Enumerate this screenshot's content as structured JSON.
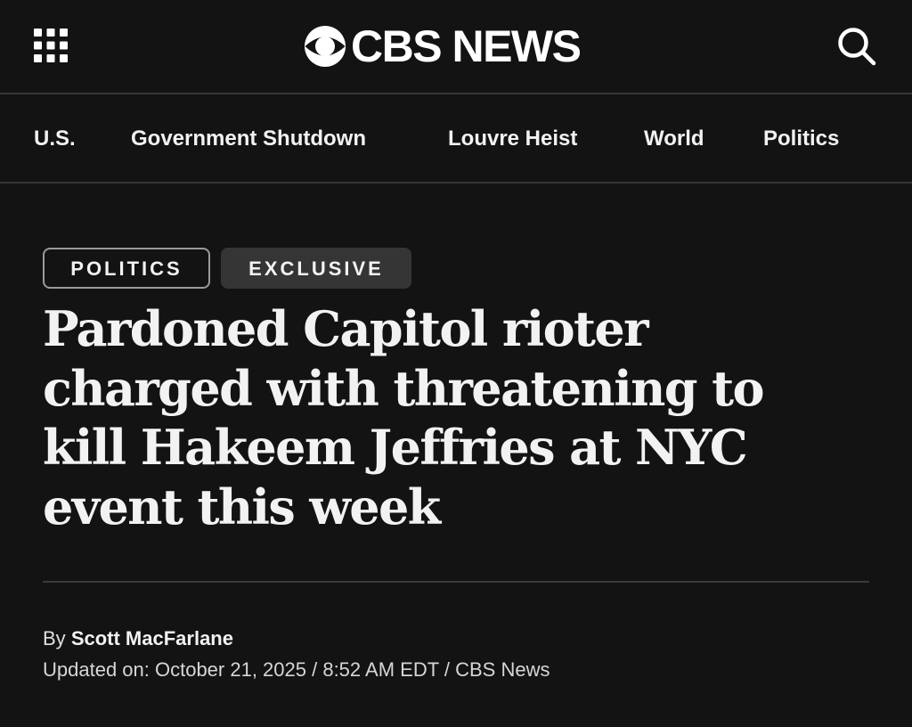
{
  "header": {
    "menu_icon": "grid-menu-icon",
    "logo_text": "CBS NEWS",
    "logo_icon": "cbs-eye-icon",
    "search_icon": "search-icon"
  },
  "nav": {
    "items": [
      {
        "label": "U.S."
      },
      {
        "label": "Government Shutdown"
      },
      {
        "label": "Louvre Heist"
      },
      {
        "label": "World"
      },
      {
        "label": "Politics"
      }
    ]
  },
  "article": {
    "tags": [
      "POLITICS",
      "EXCLUSIVE"
    ],
    "headline": "Pardoned Capitol rioter charged with threatening to kill Hakeem Jeffries at NYC event this week",
    "byline_prefix": "By",
    "author": "Scott MacFarlane",
    "updated": "Updated on: October 21, 2025 / 8:52 AM EDT / CBS News"
  },
  "colors": {
    "background": "#131313",
    "text": "#f2f2f2",
    "divider": "#353535",
    "tag_border": "#9a9a9a",
    "tag_fill": "#353535"
  }
}
